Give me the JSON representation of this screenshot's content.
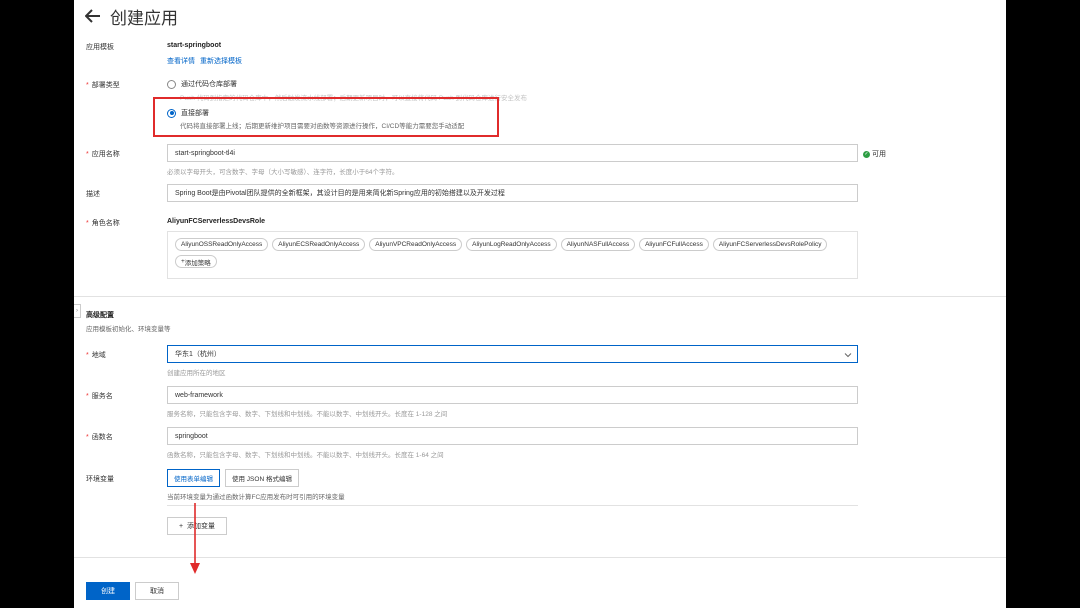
{
  "header": {
    "title": "创建应用"
  },
  "template": {
    "label": "应用模板",
    "value": "start-springboot",
    "links": [
      "查看详情",
      "重新选择模板"
    ]
  },
  "deploy": {
    "label": "部署类型",
    "option1": {
      "label": "通过代码仓库部署",
      "hint": "Push 代码到指定的代码仓库中，然后触发流水线部署；后期更新项目时，可以直接将代码 Push 到代码仓库进行安全发布"
    },
    "option2": {
      "label": "直接部署",
      "hint": "代码将直接部署上线；后期更新维护项目需要对函数等资源进行操作，CI/CD等能力需要您手动适配"
    }
  },
  "app_name": {
    "label": "应用名称",
    "value": "start-springboot-tl4i",
    "status": "可用",
    "hint": "必须以字母开头，可含数字、字母（大小写敏感）、连字符，长度小于64个字符。"
  },
  "description": {
    "label": "描述",
    "value": "Spring Boot是由Pivotal团队提供的全新框架，其设计目的是用来简化新Spring应用的初始搭建以及开发过程"
  },
  "role": {
    "label": "角色名称",
    "value": "AliyunFCServerlessDevsRole",
    "policies": [
      "AliyunOSSReadOnlyAccess",
      "AliyunECSReadOnlyAccess",
      "AliyunVPCReadOnlyAccess",
      "AliyunLogReadOnlyAccess",
      "AliyunNASFullAccess",
      "AliyunFCFullAccess",
      "AliyunFCServerlessDevsRolePolicy"
    ],
    "add_policy": "添加策略"
  },
  "advanced": {
    "title": "高级配置",
    "subtitle": "应用模板初始化、环境变量等"
  },
  "region": {
    "label": "地域",
    "value": "华东1（杭州）",
    "hint": "创建应用所在的地区"
  },
  "service": {
    "label": "服务名",
    "value": "web-framework",
    "hint": "服务名称，只能包含字母、数字、下划线和中划线。不能以数字、中划线开头。长度在 1-128 之间"
  },
  "function": {
    "label": "函数名",
    "value": "springboot",
    "hint": "函数名称，只能包含字母、数字、下划线和中划线。不能以数字、中划线开头。长度在 1-64 之间"
  },
  "env": {
    "label": "环境变量",
    "tab_form": "使用表单编辑",
    "tab_json": "使用 JSON 格式编辑",
    "hint": "当前环境变量为通过函数计算FC应用发布时可引用的环境变量",
    "add": "添加变量"
  },
  "footer": {
    "create": "创建",
    "cancel": "取消"
  },
  "colors": {
    "accent": "#0064c8",
    "highlight": "#e02b2b",
    "success": "#2e9e44"
  }
}
